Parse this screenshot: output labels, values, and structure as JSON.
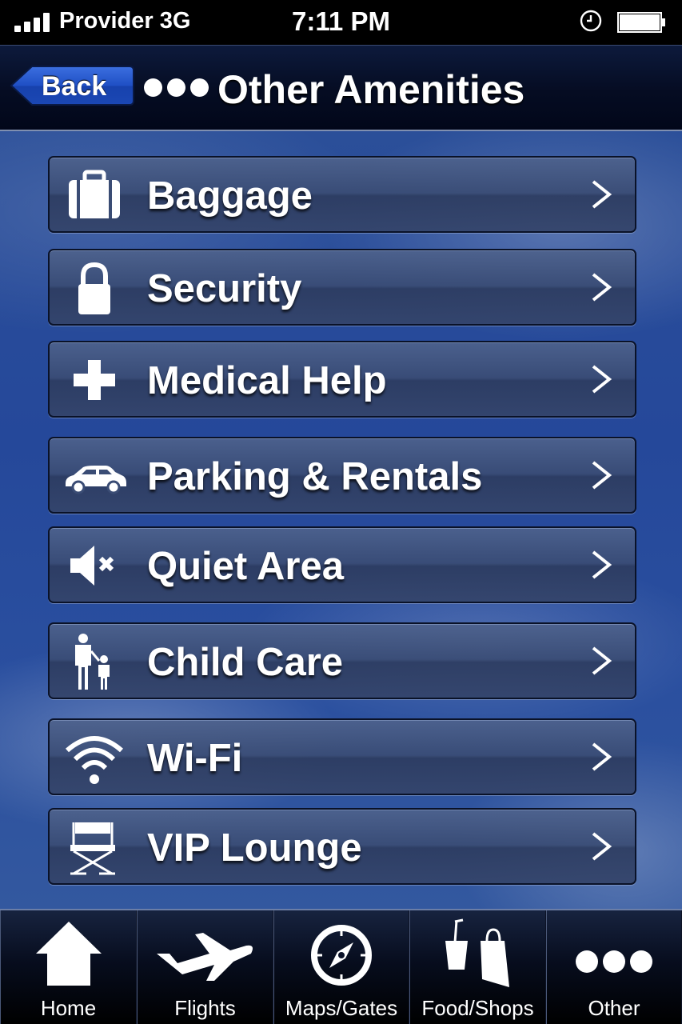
{
  "status_bar": {
    "carrier": "Provider 3G",
    "time": "7:11 PM"
  },
  "nav": {
    "back_label": "Back",
    "title": "Other Amenities"
  },
  "menu": {
    "items": [
      {
        "label": "Baggage",
        "icon": "briefcase-icon"
      },
      {
        "label": "Security",
        "icon": "lock-icon"
      },
      {
        "label": "Medical Help",
        "icon": "medical-cross-icon"
      },
      {
        "label": "Parking & Rentals",
        "icon": "car-icon"
      },
      {
        "label": "Quiet Area",
        "icon": "speaker-mute-icon"
      },
      {
        "label": "Child Care",
        "icon": "parent-child-icon"
      },
      {
        "label": "Wi-Fi",
        "icon": "wifi-icon"
      },
      {
        "label": "VIP Lounge",
        "icon": "directors-chair-icon"
      }
    ]
  },
  "tab_bar": {
    "tabs": [
      {
        "label": "Home",
        "icon": "home-icon"
      },
      {
        "label": "Flights",
        "icon": "airplane-icon"
      },
      {
        "label": "Maps/Gates",
        "icon": "compass-icon"
      },
      {
        "label": "Food/Shops",
        "icon": "drink-and-bag-icon"
      },
      {
        "label": "Other",
        "icon": "more-dots-icon"
      }
    ]
  },
  "colors": {
    "nav_background": "#050c22",
    "content_background": "#2b4f99",
    "button_background": "#3a4c74",
    "text": "#ffffff"
  }
}
